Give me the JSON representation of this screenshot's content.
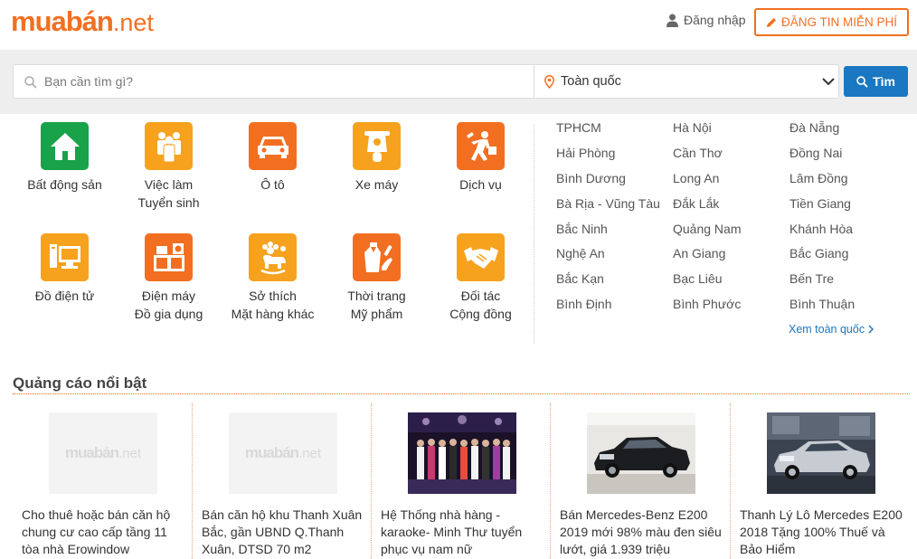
{
  "header": {
    "logo_main": "muabán",
    "logo_net": ".net",
    "login_label": "Đăng nhập",
    "post_label": "ĐĂNG TIN MIỄN PHÍ"
  },
  "search": {
    "placeholder": "Bạn cần tìm gì?",
    "location": "Toàn quốc",
    "button_label": "Tìm"
  },
  "categories": [
    {
      "line1": "Bất động sản",
      "line2": "",
      "icon": "house-icon",
      "color": "#19a24a"
    },
    {
      "line1": "Việc làm",
      "line2": "Tuyển sinh",
      "icon": "people-icon",
      "color": "#f6a21e"
    },
    {
      "line1": "Ô tô",
      "line2": "",
      "icon": "car-icon",
      "color": "#f26f21"
    },
    {
      "line1": "Xe máy",
      "line2": "",
      "icon": "scooter-icon",
      "color": "#f6a21e"
    },
    {
      "line1": "Dịch vụ",
      "line2": "",
      "icon": "service-man-icon",
      "color": "#f26f21"
    },
    {
      "line1": "Đồ điện tử",
      "line2": "",
      "icon": "computer-icon",
      "color": "#f6a21e"
    },
    {
      "line1": "Điện máy",
      "line2": "Đồ gia dụng",
      "icon": "appliance-icon",
      "color": "#f26f21"
    },
    {
      "line1": "Sở thích",
      "line2": "Mặt hàng khác",
      "icon": "hobby-icon",
      "color": "#f6a21e"
    },
    {
      "line1": "Thời trang",
      "line2": "Mỹ phẩm",
      "icon": "fashion-icon",
      "color": "#f26f21"
    },
    {
      "line1": "Đối tác",
      "line2": "Cộng đồng",
      "icon": "handshake-icon",
      "color": "#f6a21e"
    }
  ],
  "cities": [
    "TPHCM",
    "Hà Nội",
    "Đà Nẵng",
    "Hải Phòng",
    "Cần Thơ",
    "Đồng Nai",
    "Bình Dương",
    "Long An",
    "Lâm Đồng",
    "Bà Rịa - Vũng Tàu",
    "Đắk Lắk",
    "Tiền Giang",
    "Bắc Ninh",
    "Quảng Nam",
    "Khánh Hòa",
    "Nghệ An",
    "An Giang",
    "Bắc Giang",
    "Bắc Kạn",
    "Bạc Liêu",
    "Bến Tre",
    "Bình Định",
    "Bình Phước",
    "Bình Thuận"
  ],
  "see_all": "Xem toàn quốc",
  "featured": {
    "title": "Quảng cáo nổi bật",
    "ads": [
      {
        "title": "Cho thuê hoặc bán căn hộ chung cư cao cấp tầng 11 tòa nhà Erowindow",
        "image": "placeholder-logo",
        "logo_main": "muabán",
        "logo_net": ".net"
      },
      {
        "title": "Bán căn hộ khu Thanh Xuân Bắc, gần UBND Q.Thanh Xuân, DTSD 70 m2",
        "image": "placeholder-logo",
        "logo_main": "muabán",
        "logo_net": ".net"
      },
      {
        "title": "Hệ Thống nhà hàng - karaoke- Minh Thư tuyển phục vụ nam nữ",
        "image": "group-photo"
      },
      {
        "title": "Bán Mercedes-Benz E200 2019 mới 98% màu đen siêu lướt, giá 1.939 triệu",
        "image": "black-car-photo"
      },
      {
        "title": "Thanh Lý Lô Mercedes E200 2018 Tặng 100% Thuế và Bảo Hiểm",
        "image": "silver-car-photo"
      }
    ]
  },
  "colors": {
    "brand_orange": "#f26f21",
    "accent_yellow": "#f6a21e",
    "green": "#19a24a",
    "link_blue": "#1a78c2"
  }
}
